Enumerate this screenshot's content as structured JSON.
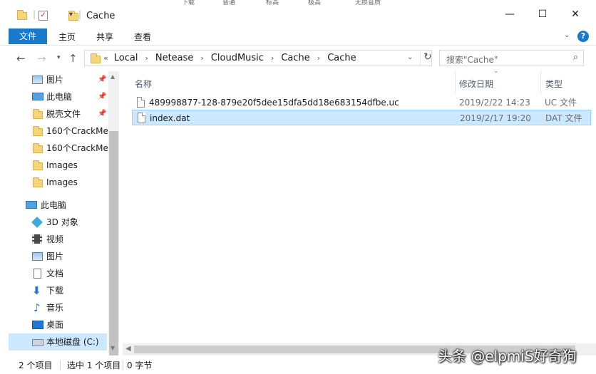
{
  "window": {
    "title": "Cache",
    "controls": {
      "minimize": "—",
      "maximize": "☐",
      "close": "✕"
    }
  },
  "background_toolbar": [
    "下载",
    "普通",
    "标高",
    "极高",
    "无损音质"
  ],
  "ribbon": {
    "file_tab": "文件",
    "tabs": [
      "主页",
      "共享",
      "查看"
    ],
    "help": "?"
  },
  "address": {
    "overflow": "«",
    "crumbs": [
      "Local",
      "Netease",
      "CloudMusic",
      "Cache",
      "Cache"
    ],
    "search_placeholder": "搜索\"Cache\""
  },
  "sidebar": {
    "quick_access": [
      {
        "label": "图片",
        "icon": "pictures-icon",
        "pinned": true
      },
      {
        "label": "此电脑",
        "icon": "this-pc-icon",
        "pinned": true
      },
      {
        "label": "脱壳文件",
        "icon": "folder-icon",
        "pinned": true
      },
      {
        "label": "160个CrackMe",
        "icon": "folder-icon",
        "pinned": false
      },
      {
        "label": "160个CrackMe",
        "icon": "folder-icon",
        "pinned": false
      },
      {
        "label": "Images",
        "icon": "folder-icon",
        "pinned": false
      },
      {
        "label": "Images",
        "icon": "folder-icon",
        "pinned": false
      }
    ],
    "this_pc_label": "此电脑",
    "this_pc_children": [
      {
        "label": "3D 对象",
        "icon": "3d-objects-icon"
      },
      {
        "label": "视频",
        "icon": "video-icon"
      },
      {
        "label": "图片",
        "icon": "pictures-icon"
      },
      {
        "label": "文档",
        "icon": "documents-icon"
      },
      {
        "label": "下载",
        "icon": "download-icon"
      },
      {
        "label": "音乐",
        "icon": "music-icon"
      },
      {
        "label": "桌面",
        "icon": "desktop-icon"
      },
      {
        "label": "本地磁盘 (C:)",
        "icon": "drive-icon",
        "selected": true
      }
    ]
  },
  "columns": {
    "name": "名称",
    "modified": "修改日期",
    "type": "类型"
  },
  "files": [
    {
      "name": "489998877-128-879e20f5dee15dfa5dd18e683154dfbe.uc",
      "modified": "2019/2/22 14:23",
      "type": "UC 文件",
      "selected": false
    },
    {
      "name": "index.dat",
      "modified": "2019/2/17 19:20",
      "type": "DAT 文件",
      "selected": true
    }
  ],
  "status": {
    "count": "2 个项目",
    "selection": "选中 1 个项目",
    "size": "0 字节"
  },
  "watermark": "头条 @elpmiS好奇狗"
}
